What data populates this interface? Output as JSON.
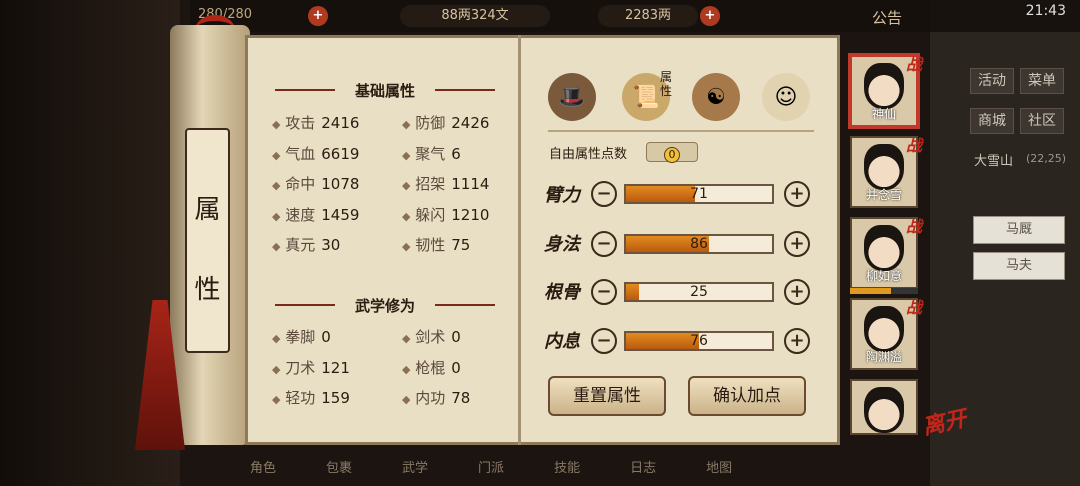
{
  "topbar": {
    "stamina": "280/280",
    "money": "88两324文",
    "ingots": "2283两",
    "notice": "公告",
    "time": "21:43"
  },
  "scroll_title": "属 性",
  "basic": {
    "title": "基础属性",
    "items": [
      {
        "label": "攻击",
        "value": "2416"
      },
      {
        "label": "防御",
        "value": "2426"
      },
      {
        "label": "气血",
        "value": "6619"
      },
      {
        "label": "聚气",
        "value": "6"
      },
      {
        "label": "命中",
        "value": "1078"
      },
      {
        "label": "招架",
        "value": "1114"
      },
      {
        "label": "速度",
        "value": "1459"
      },
      {
        "label": "躲闪",
        "value": "1210"
      },
      {
        "label": "真元",
        "value": "30"
      },
      {
        "label": "韧性",
        "value": "75"
      }
    ]
  },
  "martial": {
    "title": "武学修为",
    "items": [
      {
        "label": "拳脚",
        "value": "0"
      },
      {
        "label": "剑术",
        "value": "0"
      },
      {
        "label": "刀术",
        "value": "121"
      },
      {
        "label": "枪棍",
        "value": "0"
      },
      {
        "label": "轻功",
        "value": "159"
      },
      {
        "label": "内功",
        "value": "78"
      }
    ]
  },
  "tab_icons": [
    "hat-icon",
    "book-attr-icon",
    "bagua-icon",
    "monk-icon"
  ],
  "tab_attr_label": "属性",
  "free_points": {
    "label": "自由属性点数",
    "value": "0"
  },
  "stats": [
    {
      "label": "臂力",
      "value": "71",
      "fill": 0.47
    },
    {
      "label": "身法",
      "value": "86",
      "fill": 0.57
    },
    {
      "label": "根骨",
      "value": "25",
      "fill": 0.09
    },
    {
      "label": "内息",
      "value": "76",
      "fill": 0.5
    }
  ],
  "buttons": {
    "reset": "重置属性",
    "confirm": "确认加点"
  },
  "roster": [
    {
      "name": "神仙",
      "tag": "战"
    },
    {
      "name": "并念雪",
      "tag": "战"
    },
    {
      "name": "柳如意",
      "tag": "战"
    },
    {
      "name": "陶渊溢",
      "tag": "战"
    },
    {
      "name": "",
      "tag": ""
    }
  ],
  "leave": "离开",
  "right_menu": {
    "activity": "活动",
    "menu": "菜单",
    "shop": "商城",
    "community": "社区",
    "location": "大雪山",
    "coords": "(22,25)",
    "npc1": "马厩",
    "npc2": "马夫"
  },
  "bottom_tabs": [
    "角色",
    "包裹",
    "武学",
    "门派",
    "技能",
    "日志",
    "地图"
  ]
}
